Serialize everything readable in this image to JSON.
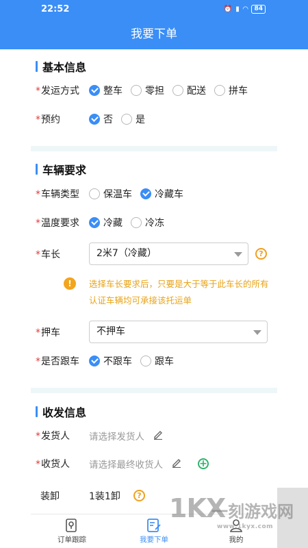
{
  "status": {
    "time": "22:52",
    "battery": "84"
  },
  "header": {
    "title": "我要下单"
  },
  "basic": {
    "title": "基本信息",
    "ship_method": {
      "label": "发运方式",
      "options": [
        "整车",
        "零担",
        "配送",
        "拼车"
      ],
      "selected": "整车"
    },
    "appointment": {
      "label": "预约",
      "options": [
        "否",
        "是"
      ],
      "selected": "否"
    }
  },
  "vehicle": {
    "title": "车辆要求",
    "type": {
      "label": "车辆类型",
      "options": [
        "保温车",
        "冷藏车"
      ],
      "selected": "冷藏车"
    },
    "temperature": {
      "label": "温度要求",
      "options": [
        "冷藏",
        "冷冻"
      ],
      "selected": "冷藏"
    },
    "length": {
      "label": "车长",
      "value": "2米7（冷藏）"
    },
    "notice": "选择车长要求后，只要是大于等于此车长的所有认证车辆均可承接该托运单",
    "escort": {
      "label": "押车",
      "value": "不押车"
    },
    "follow": {
      "label": "是否跟车",
      "options": [
        "不跟车",
        "跟车"
      ],
      "selected": "不跟车"
    }
  },
  "shipping": {
    "title": "收发信息",
    "sender": {
      "label": "发货人",
      "placeholder": "请选择发货人"
    },
    "receiver": {
      "label": "收货人",
      "placeholder": "请选择最终收货人"
    },
    "loading": {
      "label": "装卸",
      "value": "1装1卸"
    }
  },
  "tabs": [
    {
      "label": "订单跟踪",
      "icon": "location-doc-icon"
    },
    {
      "label": "我要下单",
      "icon": "edit-doc-icon"
    },
    {
      "label": "我的",
      "icon": "person-icon"
    }
  ],
  "watermark": {
    "big": "1KX",
    "cn": "一刻游戏网",
    "url": "www.1kyx.com"
  },
  "colors": {
    "primary": "#3a8ef6",
    "required": "#e03a3a",
    "warning": "#f3a51d",
    "add": "#2db36b"
  }
}
